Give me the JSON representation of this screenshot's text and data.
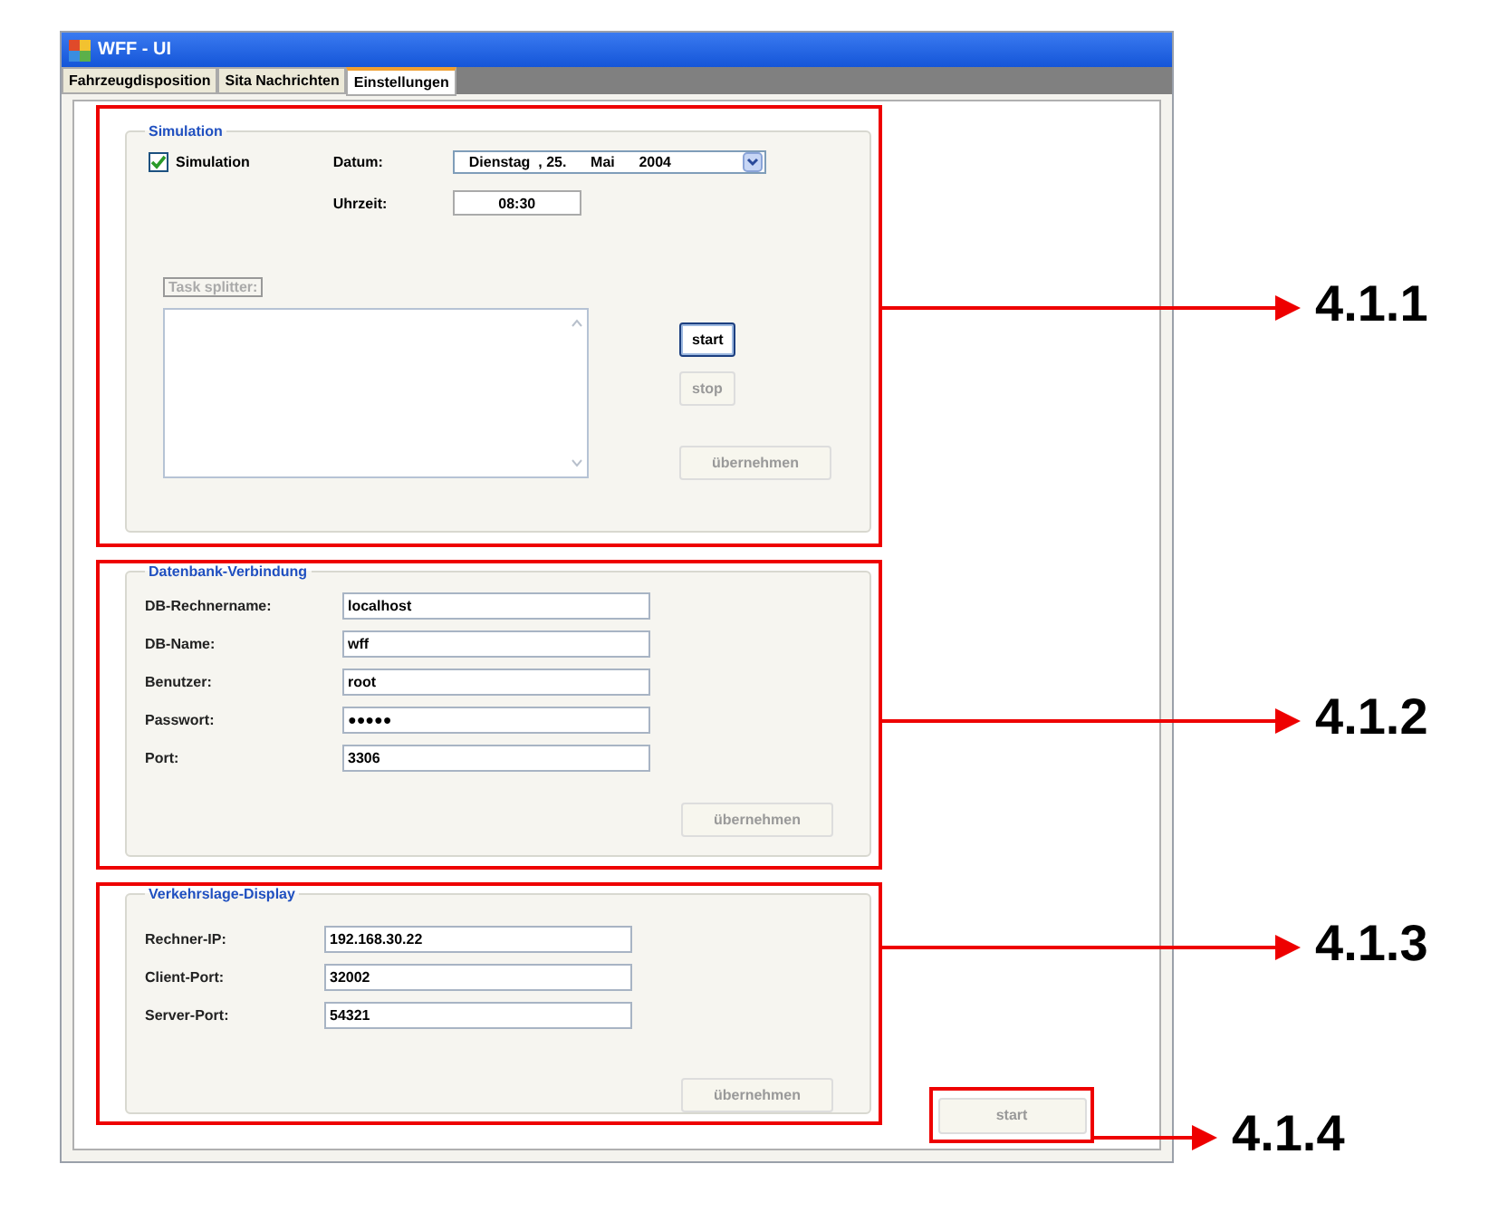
{
  "window": {
    "title": "WFF - UI"
  },
  "tabs": [
    {
      "label": "Fahrzeugdisposition",
      "selected": false
    },
    {
      "label": "Sita Nachrichten",
      "selected": false
    },
    {
      "label": "Einstellungen",
      "selected": true
    }
  ],
  "simulation": {
    "title": "Simulation",
    "checkbox": {
      "label": "Simulation",
      "checked": true
    },
    "date_label": "Datum:",
    "date_value": "Dienstag  , 25.      Mai      2004",
    "time_label": "Uhrzeit:",
    "time_value": "08:30",
    "task_splitter_label": "Task splitter:",
    "buttons": [
      {
        "label": "start",
        "kind": "default"
      },
      {
        "label": "stop",
        "kind": "disabled"
      },
      {
        "label": "übernehmen",
        "kind": "disabled"
      }
    ]
  },
  "database": {
    "title": "Datenbank-Verbindung",
    "fields": [
      {
        "label": "DB-Rechnername:",
        "value": "localhost"
      },
      {
        "label": "DB-Name:",
        "value": "wff"
      },
      {
        "label": "Benutzer:",
        "value": "root"
      },
      {
        "label": "Passwort:",
        "value": "●●●●●"
      },
      {
        "label": "Port:",
        "value": "3306"
      }
    ],
    "button": "übernehmen"
  },
  "display": {
    "title": "Verkehrslage-Display",
    "fields": [
      {
        "label": "Rechner-IP:",
        "value": "192.168.30.22"
      },
      {
        "label": "Client-Port:",
        "value": "32002"
      },
      {
        "label": "Server-Port:",
        "value": "54321"
      }
    ],
    "button": "übernehmen"
  },
  "start_button": "start",
  "annotations": [
    {
      "label": "4.1.1"
    },
    {
      "label": "4.1.2"
    },
    {
      "label": "4.1.3"
    },
    {
      "label": "4.1.4"
    }
  ]
}
